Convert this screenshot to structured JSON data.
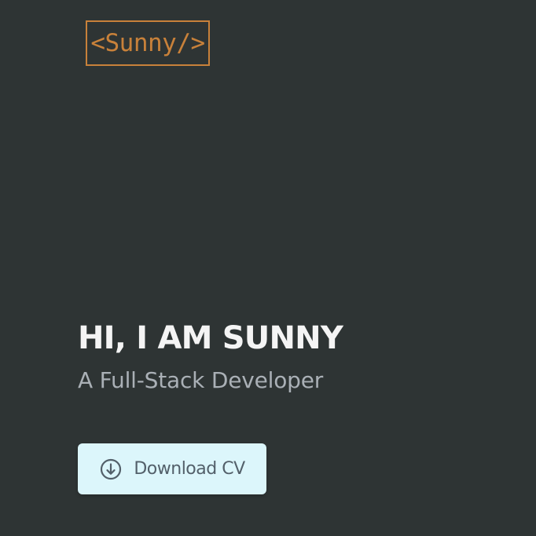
{
  "logo": {
    "text": "<Sunny/>"
  },
  "hero": {
    "title": "HI, I AM SUNNY",
    "subtitle": "A Full-Stack Developer",
    "download_button_label": "Download CV",
    "download_icon": "download-circle-icon"
  },
  "colors": {
    "background": "#2e3434",
    "accent": "#c8813a",
    "title_text": "#f4f4f4",
    "subtitle_text": "#aab0b6",
    "button_background": "#dcf6fb",
    "button_text": "#53606a"
  }
}
